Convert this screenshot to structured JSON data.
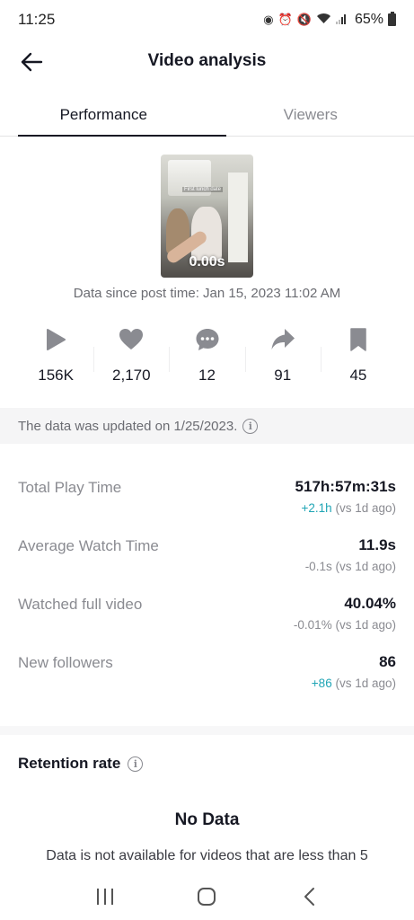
{
  "status_bar": {
    "time": "11:25",
    "battery": "65%"
  },
  "header": {
    "title": "Video analysis"
  },
  "tabs": [
    {
      "label": "Performance",
      "active": true
    },
    {
      "label": "Viewers",
      "active": false
    }
  ],
  "video": {
    "duration": "0.00s",
    "caption": "First lunch date"
  },
  "post_time": "Data since post time: Jan 15, 2023 11:02 AM",
  "stats": [
    {
      "icon": "play-icon",
      "value": "156K"
    },
    {
      "icon": "heart-icon",
      "value": "2,170"
    },
    {
      "icon": "comment-icon",
      "value": "12"
    },
    {
      "icon": "share-icon",
      "value": "91"
    },
    {
      "icon": "bookmark-icon",
      "value": "45"
    }
  ],
  "updated_banner": "The data was updated on 1/25/2023.",
  "metrics": [
    {
      "label": "Total Play Time",
      "value": "517h:57m:31s",
      "delta": "+2.1h",
      "delta_suffix": " (vs 1d ago)",
      "delta_positive": true
    },
    {
      "label": "Average Watch Time",
      "value": "11.9s",
      "delta": "-0.1s",
      "delta_suffix": " (vs 1d ago)",
      "delta_positive": false
    },
    {
      "label": "Watched full video",
      "value": "40.04%",
      "delta": "-0.01%",
      "delta_suffix": " (vs 1d ago)",
      "delta_positive": false
    },
    {
      "label": "New followers",
      "value": "86",
      "delta": "+86",
      "delta_suffix": " (vs 1d ago)",
      "delta_positive": true
    }
  ],
  "retention": {
    "title": "Retention rate",
    "no_data_title": "No Data",
    "no_data_desc": "Data is not available for videos that are less than 5"
  },
  "colors": {
    "accent_positive": "#20a5b5",
    "text_primary": "#161823",
    "text_secondary": "#8a8b91"
  }
}
